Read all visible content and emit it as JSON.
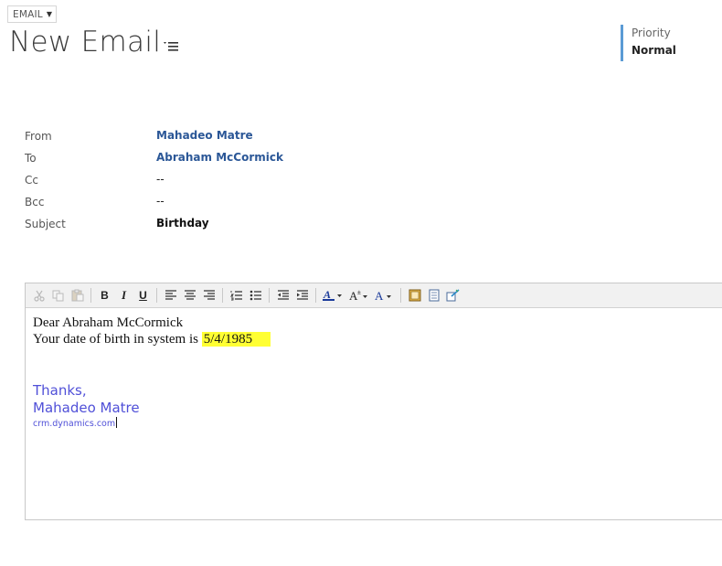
{
  "header": {
    "entity_label": "EMAIL",
    "title": "New Email",
    "priority_label": "Priority",
    "priority_value": "Normal"
  },
  "fields": [
    {
      "label": "From",
      "value": "Mahadeo Matre"
    },
    {
      "label": "To",
      "value": "Abraham McCormick"
    },
    {
      "label": "Cc",
      "value": "--"
    },
    {
      "label": "Bcc",
      "value": "--"
    },
    {
      "label": "Subject",
      "value": "Birthday"
    }
  ],
  "body": {
    "greeting": "Dear Abraham McCormick",
    "dob_prefix": "Your date of birth in system is ",
    "dob_value": "5/4/1985",
    "thanks": "Thanks,",
    "signature_name": "Mahadeo Matre",
    "signature_site": "crm.dynamics.com",
    "highlight_color": "#ffff33",
    "signature_color": "#5050d8"
  },
  "toolbar_icons": [
    "cut-icon",
    "copy-icon",
    "paste-icon",
    "bold-icon",
    "italic-icon",
    "underline-icon",
    "align-left-icon",
    "align-center-icon",
    "align-right-icon",
    "numbered-list-icon",
    "bullet-list-icon",
    "decrease-indent-icon",
    "increase-indent-icon",
    "highlight-color-icon",
    "font-size-icon",
    "font-color-icon",
    "insert-image-icon",
    "insert-template-icon",
    "spellcheck-icon"
  ],
  "toolbar_labels": {
    "bold": "B",
    "italic": "I",
    "underline": "U"
  },
  "colors": {
    "accent_blue": "#5b9bd5",
    "link_blue": "#2b5797"
  }
}
